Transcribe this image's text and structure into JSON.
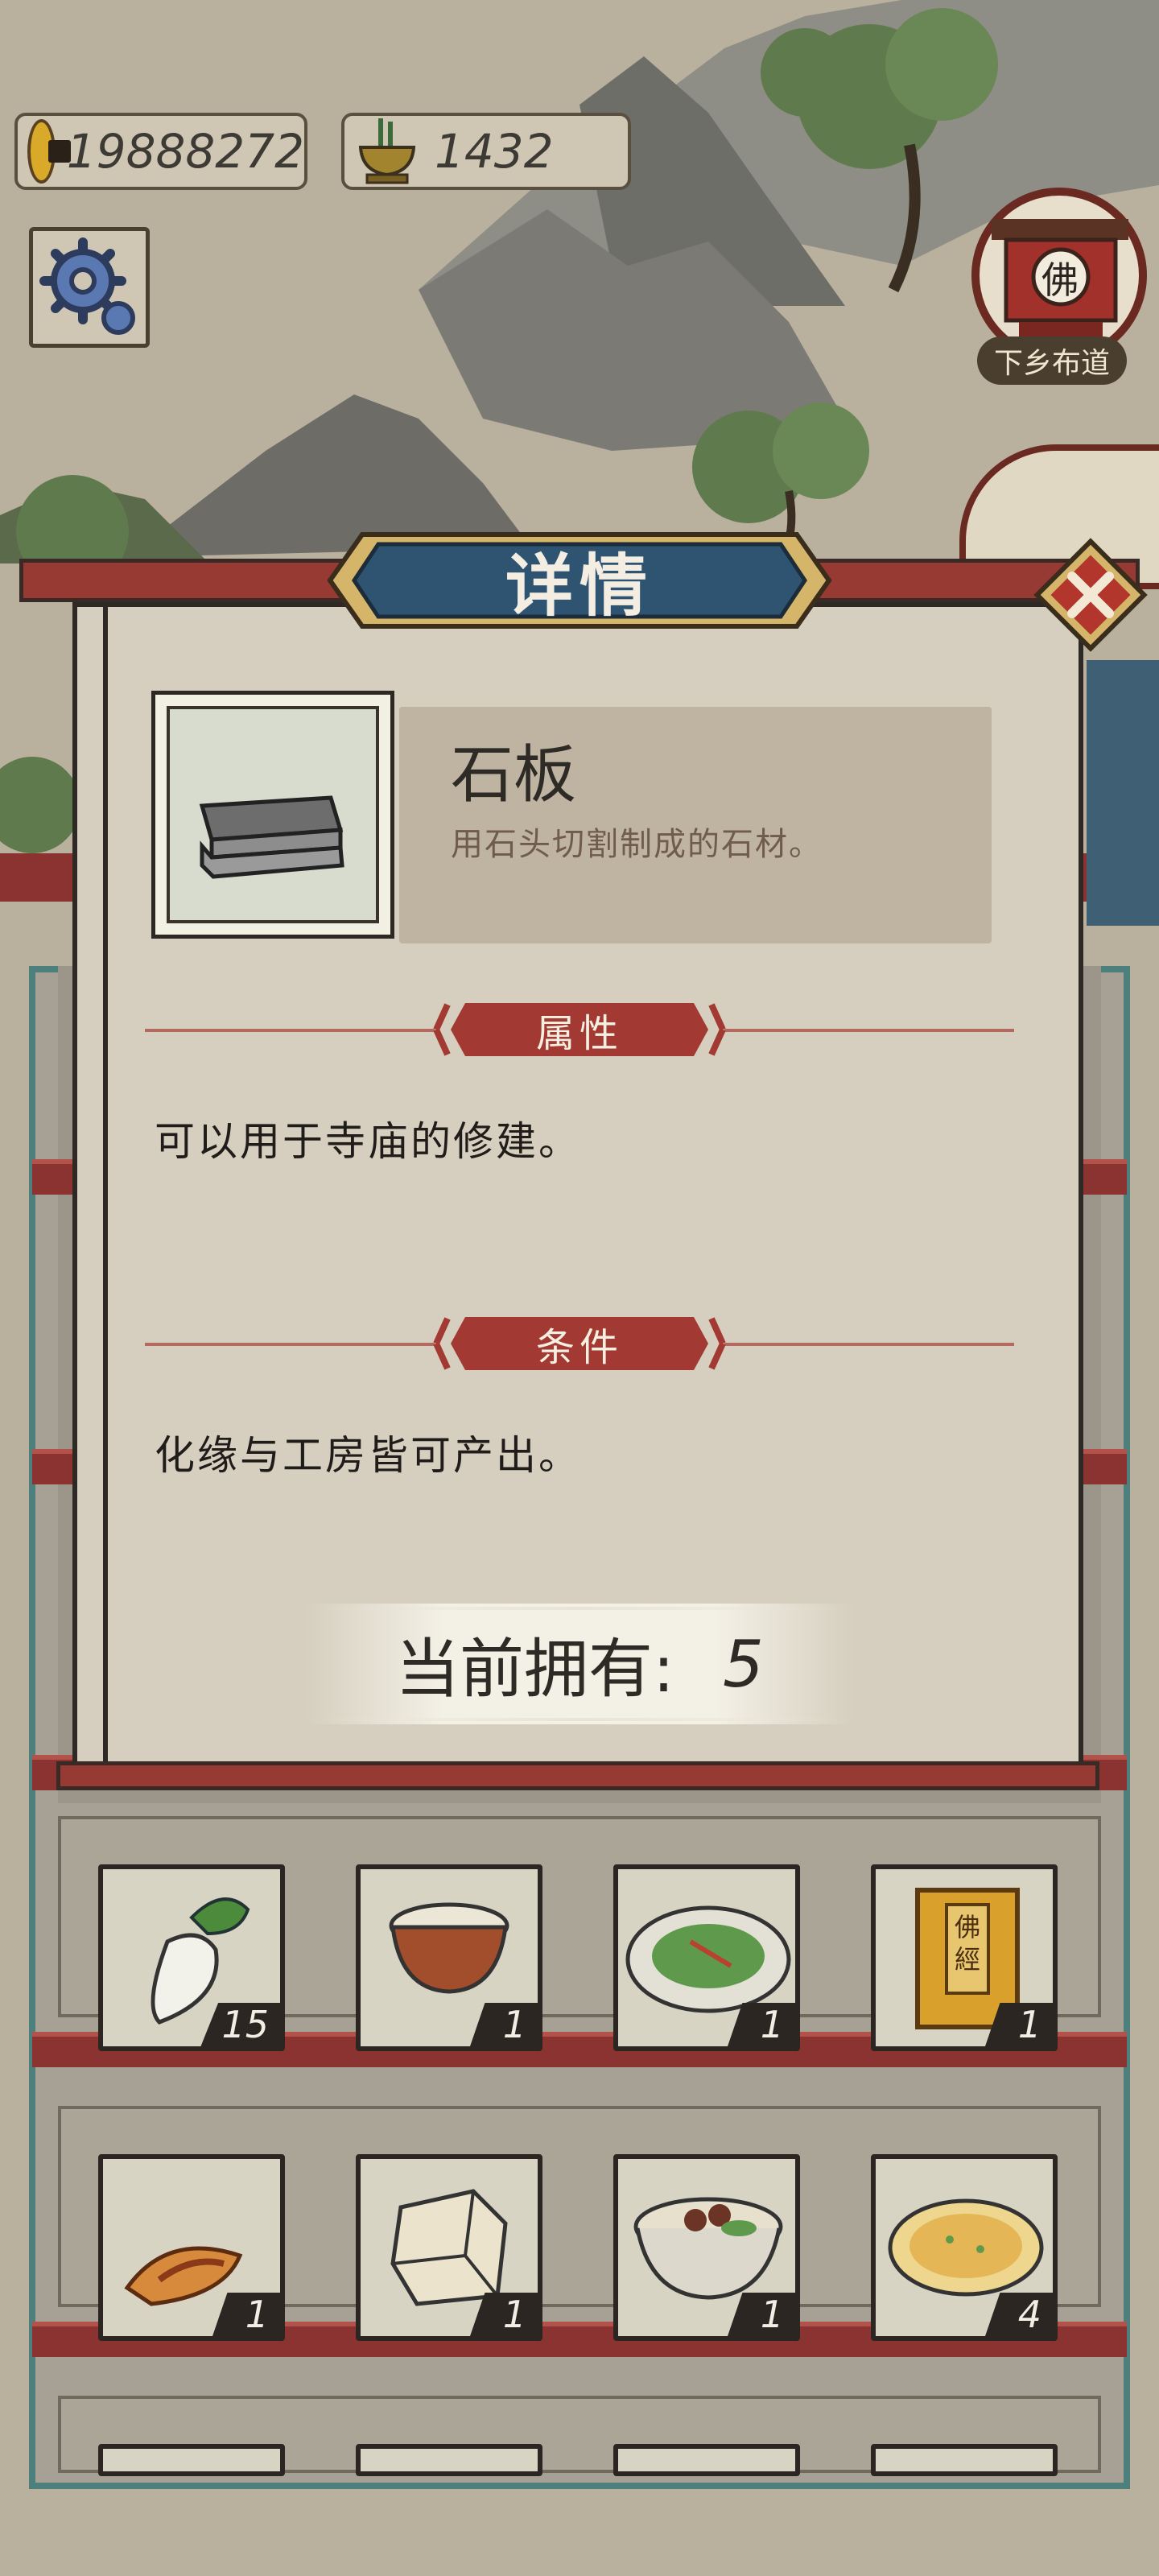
{
  "currency": {
    "coins": "19888272",
    "incense": "1432"
  },
  "side_menu": {
    "temple_sign": "佛",
    "travel_label": "下乡布道"
  },
  "modal": {
    "title": "详情",
    "item": {
      "name": "石板",
      "description": "用石头切割制成的石材。"
    },
    "attributes_heading": "属性",
    "attributes_text": "可以用于寺庙的修建。",
    "conditions_heading": "条件",
    "conditions_text": "化缘与工房皆可产出。",
    "owned_label": "当前拥有:",
    "owned_count": "5"
  },
  "inventory": {
    "row1": [
      {
        "icon": "radish-icon",
        "count": "15"
      },
      {
        "icon": "rice-bowl-icon",
        "count": "1"
      },
      {
        "icon": "greens-plate-icon",
        "count": "1"
      },
      {
        "icon": "sutra-book-icon",
        "count": "1",
        "label": "佛經"
      }
    ],
    "row2": [
      {
        "icon": "roasted-sweet-potato-icon",
        "count": "1"
      },
      {
        "icon": "tofu-icon",
        "count": "1"
      },
      {
        "icon": "mushroom-soup-icon",
        "count": "1"
      },
      {
        "icon": "pancake-icon",
        "count": "4"
      }
    ]
  }
}
